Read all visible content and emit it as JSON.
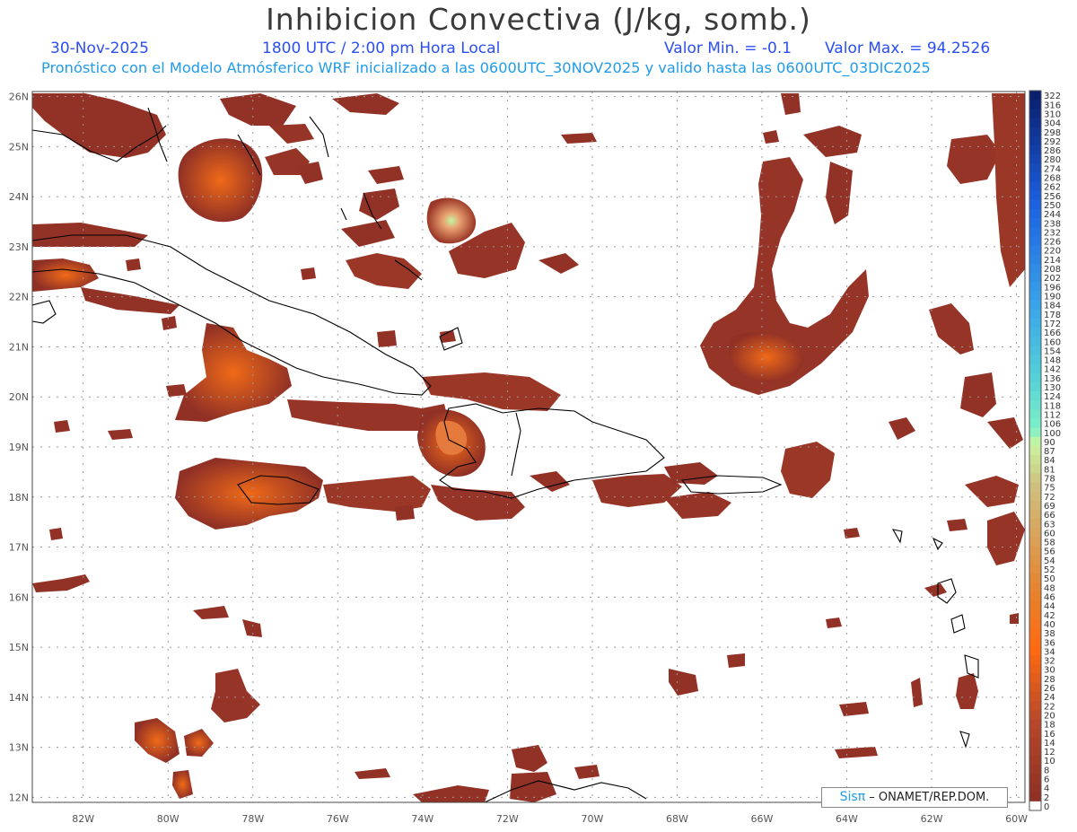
{
  "header": {
    "title": "Inhibicion Convectiva (J/kg, somb.)",
    "date": "30-Nov-2025",
    "time": "1800 UTC / 2:00 pm Hora Local",
    "valor_min": "Valor Min. = -0.1",
    "valor_max": "Valor Max. = 94.2526",
    "forecast": "Pronóstico con el Modelo Atmósferico WRF inicializado a las 0600UTC_30NOV2025 y valido hasta las  0600UTC_03DIC2025"
  },
  "axes": {
    "lon_labels": [
      "82W",
      "80W",
      "78W",
      "76W",
      "74W",
      "72W",
      "70W",
      "68W",
      "66W",
      "64W",
      "62W",
      "60W"
    ],
    "lon_values": [
      -82,
      -80,
      -78,
      -76,
      -74,
      -72,
      -70,
      -68,
      -66,
      -64,
      -62,
      -60
    ],
    "lat_labels": [
      "26N",
      "25N",
      "24N",
      "23N",
      "22N",
      "21N",
      "20N",
      "19N",
      "18N",
      "17N",
      "16N",
      "15N",
      "14N",
      "13N",
      "12N"
    ],
    "lat_values": [
      26,
      25,
      24,
      23,
      22,
      21,
      20,
      19,
      18,
      17,
      16,
      15,
      14,
      13,
      12
    ],
    "lon_range": [
      -83.2,
      -59.8
    ],
    "lat_range": [
      11.9,
      26.1
    ]
  },
  "colorbar": {
    "labels": [
      "322",
      "316",
      "310",
      "304",
      "298",
      "292",
      "286",
      "280",
      "274",
      "268",
      "262",
      "256",
      "250",
      "244",
      "238",
      "232",
      "226",
      "220",
      "214",
      "208",
      "202",
      "196",
      "190",
      "184",
      "178",
      "172",
      "166",
      "160",
      "154",
      "148",
      "142",
      "136",
      "130",
      "124",
      "118",
      "112",
      "106",
      "100",
      "90",
      "87",
      "84",
      "81",
      "78",
      "75",
      "72",
      "69",
      "66",
      "63",
      "60",
      "58",
      "56",
      "54",
      "52",
      "50",
      "48",
      "46",
      "44",
      "42",
      "40",
      "38",
      "36",
      "34",
      "32",
      "30",
      "28",
      "26",
      "24",
      "22",
      "20",
      "18",
      "16",
      "14",
      "12",
      "10",
      "8",
      "6",
      "4",
      "2",
      "0"
    ],
    "colors": {
      "dark_blue": "#0a1f6e",
      "blue": "#1b5fe0",
      "sky": "#3aa6ea",
      "teal": "#56d2d6",
      "aqua": "#7ef0c8",
      "pale_green": "#c9f5a0",
      "khaki": "#cfc080",
      "orange": "#e6822e",
      "bright_orange": "#ff6a10",
      "red_brown": "#b8482a",
      "dark_brown": "#8a2e24"
    }
  },
  "field_colors": {
    "base": "#913126",
    "mid": "#b84a2a",
    "hot": "#e7601a",
    "peak": "#b9ef9a"
  },
  "credit": {
    "brand": "Sisπ",
    "org": "– ONAMET/REP.DOM."
  }
}
